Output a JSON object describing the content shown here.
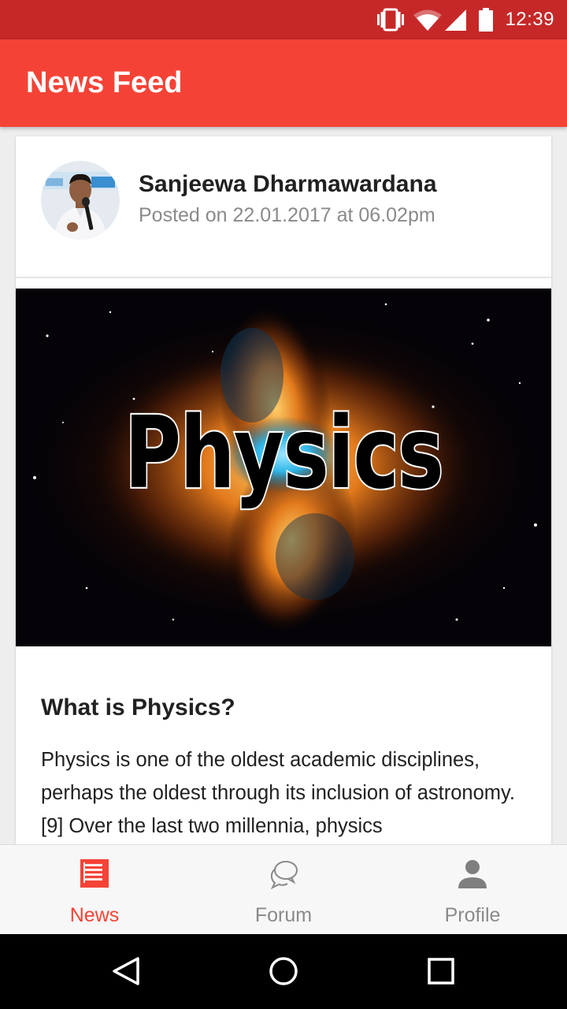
{
  "status_bar": {
    "time": "12:39",
    "icons": [
      "vibrate-icon",
      "wifi-icon",
      "signal-icon",
      "battery-icon"
    ],
    "color": "#c62828"
  },
  "app_bar": {
    "title": "News Feed",
    "color": "#f44336"
  },
  "post": {
    "author": "Sanjeewa Dharmawardana",
    "posted": "Posted on 22.01.2017 at 06.02pm",
    "avatar_icon": "author-avatar",
    "image_text": "Physics",
    "title": "What is Physics?",
    "body": "Physics is one of the oldest academic disciplines, perhaps the oldest through its inclusion of astronomy.[9] Over the last two millennia, physics"
  },
  "bottom_nav": {
    "items": [
      {
        "label": "News",
        "icon": "news-icon",
        "active": true
      },
      {
        "label": "Forum",
        "icon": "forum-icon",
        "active": false
      },
      {
        "label": "Profile",
        "icon": "profile-icon",
        "active": false
      }
    ],
    "active_color": "#f44336",
    "inactive_color": "#8a8a8a"
  },
  "system_nav": {
    "buttons": [
      "back-icon",
      "home-icon",
      "recents-icon"
    ]
  }
}
